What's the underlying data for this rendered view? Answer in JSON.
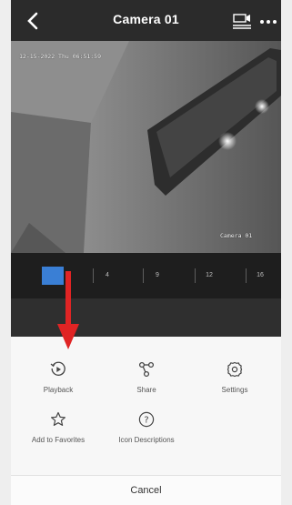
{
  "header": {
    "title": "Camera 01"
  },
  "video": {
    "timestamp": "12-15-2022 Thu 06:51:59",
    "camera_name": "Camera 01"
  },
  "split_options": [
    "1",
    "4",
    "9",
    "12",
    "16"
  ],
  "actions": {
    "playback": "Playback",
    "share": "Share",
    "settings": "Settings",
    "favorites": "Add to Favorites",
    "icon_descriptions": "Icon Descriptions"
  },
  "cancel_label": "Cancel",
  "colors": {
    "accent": "#3a7fd5",
    "annotation": "#e02424"
  },
  "icons": [
    "back-icon",
    "cast-icon",
    "more-icon",
    "playback-icon",
    "share-icon",
    "settings-icon",
    "star-icon",
    "help-icon"
  ]
}
